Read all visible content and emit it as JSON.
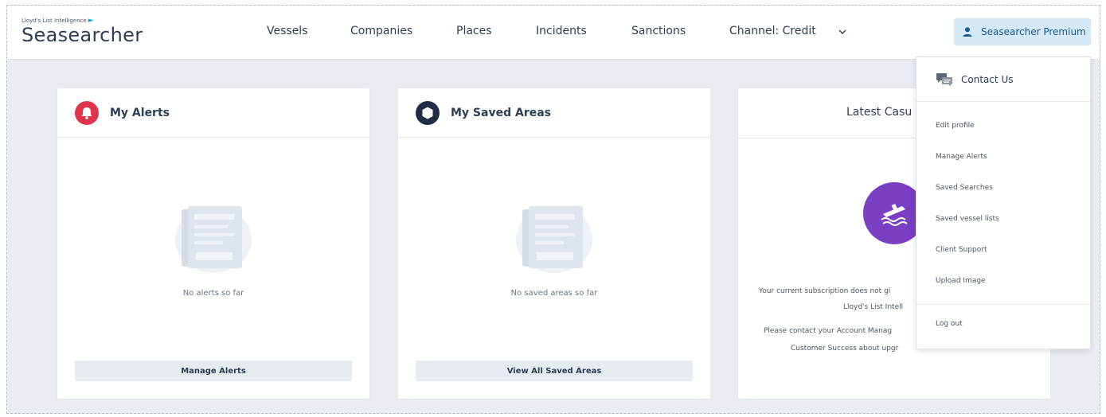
{
  "brand": {
    "small": "Lloyd's List Intelligence",
    "name": "Seasearcher"
  },
  "nav": {
    "items": [
      "Vessels",
      "Companies",
      "Places",
      "Incidents",
      "Sanctions",
      "Channel: Credit"
    ]
  },
  "account": {
    "label": "Seasearcher Premium"
  },
  "cards": {
    "alerts": {
      "title": "My Alerts",
      "empty": "No alerts so far",
      "button": "Manage Alerts"
    },
    "areas": {
      "title": "My Saved Areas",
      "empty": "No saved areas so far",
      "button": "View All Saved Areas"
    },
    "casualty": {
      "title": "Latest Casu",
      "lines": [
        "Your current subscription does not gi",
        "Lloyd's List Intell",
        "Please contact your Account Manag",
        "Customer Success about upgr"
      ]
    }
  },
  "menu": {
    "contact": "Contact Us",
    "items": [
      "Edit profile",
      "Manage Alerts",
      "Saved Searches",
      "Saved vessel lists",
      "Client Support",
      "Upload Image"
    ],
    "logout": "Log out"
  },
  "colors": {
    "alert_red": "#e0344c",
    "navy": "#1f2e45",
    "casualty_purple": "#7b3fc4",
    "accent_blue": "#1a5a92"
  }
}
